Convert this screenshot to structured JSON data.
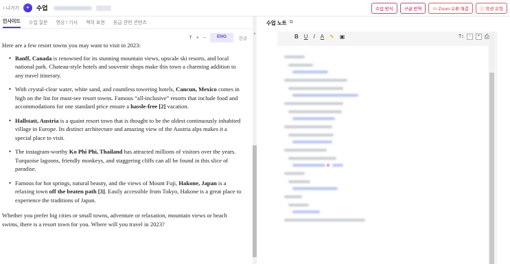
{
  "topbar": {
    "back_label": "나가기",
    "title": "수업",
    "buttons": [
      {
        "label": "수업 방식",
        "icon": ""
      },
      {
        "label": "구글 번역",
        "icon": ""
      },
      {
        "label": "Zoom 오류 해결",
        "icon": "camera-icon"
      },
      {
        "label": "학생 유형",
        "icon": "alert-icon"
      }
    ]
  },
  "left": {
    "tabs": [
      "인사이드",
      "수업 질문",
      "영상 / 기사",
      "책의 표현",
      "등급 관련 콘텐츠"
    ],
    "active_tab": 0,
    "font_controls": {
      "size_icon": "T",
      "plus": "+",
      "minus": "−"
    },
    "lang": {
      "eng": "ENG",
      "kor": "한글"
    },
    "article": {
      "intro": "Here are a few resort towns you may want to visit in 2023:",
      "items": [
        {
          "bold": "Banff, Canada",
          "text": " is renowned for its stunning mountain views, upscale ski resorts, and local national park. Chateau-style hotels and souvenir shops make this town a charming addition to any travel itinerary."
        },
        {
          "pre": "With crystal-clear water, white sand, and countless towering hotels, ",
          "bold": "Cancun, Mexico",
          "text": " comes in high on the list for must-see resort towns. Famous “all-inclusive” resorts that include food and accommodations  for one standard price ensure a ",
          "bold2": "hassle-free [2]",
          "post": " vacation."
        },
        {
          "bold": "Hallstatt, Austria",
          "text": " is a quaint resort town that is thought to be the oldest continuously inhabited village in Europe. Its distinct architecture and amazing view of the Austria alps makes it a special place to visit."
        },
        {
          "pre": "The instagram-worthy ",
          "bold": "Ko Phi Phi, Thailand",
          "text": " has attracted millions of visitors over the years. Turquoise lagoons, friendly monkeys, and staggering cliffs can all be found in this slice of paradise."
        },
        {
          "pre": "Famous for hot springs, natural beauty, and the views of Mount Fuji, ",
          "bold": "Hakone, Japan",
          "text": " is a relaxing town ",
          "bold2": "off the beaten path [3]",
          "post": ". Easily accessible from Tokyo, Hakone is a great place to experience the traditions of Japan."
        }
      ],
      "outro": "Whether you prefer big cities or small towns, adventure or relaxation, mountain views or beach swims, there is a resort town for you. Where will you travel in 2023?"
    }
  },
  "right": {
    "notes_title": "수업 노트",
    "toolbar": {
      "bold": "B",
      "underline": "U",
      "italic": "I",
      "font_color": "A",
      "highlight": "✎",
      "image": "▣",
      "size": "T↕",
      "minus": "−",
      "plus": "+",
      "print": "⎙"
    }
  },
  "colors": {
    "accent": "#4b3cd6",
    "button_border": "#c94a7a",
    "link_blue": "#b8c4f2"
  }
}
